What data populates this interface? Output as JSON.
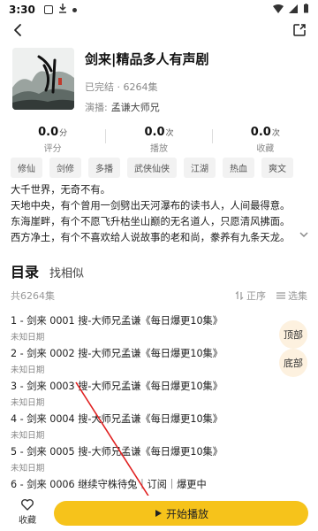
{
  "status_bar": {
    "time": "3:30"
  },
  "book": {
    "title": "剑来|精品多人有声剧",
    "meta": "已完结 · 6264集",
    "cast_label": "演播:",
    "caster": "孟谦大师兄"
  },
  "stats": [
    {
      "value": "0.0",
      "unit": "分",
      "label": "评分"
    },
    {
      "value": "0.0",
      "unit": "次",
      "label": "播放"
    },
    {
      "value": "0.0",
      "unit": "次",
      "label": "收藏"
    }
  ],
  "tags": [
    "修仙",
    "剑修",
    "多播",
    "武侠仙侠",
    "江湖",
    "热血",
    "爽文"
  ],
  "description": [
    "大千世界，无奇不有。",
    "天地中央，有个曾用一剑劈出天河瀑布的读书人，人间最得意。",
    "东海崖畔，有个不愿飞升枯坐山巅的无名道人，只愿清风拂面。",
    "西方净土，有个不喜欢给人说故事的老和尚，豢养有九条天龙。"
  ],
  "catalog": {
    "title": "目录",
    "similar": "找相似",
    "count": "共6264集",
    "sort_label": "正序",
    "select_label": "选集"
  },
  "episodes": [
    {
      "title": "1 - 剑来 0001 搜-大师兄孟谦《每日爆更10集》",
      "date": "未知日期"
    },
    {
      "title": "2 - 剑来 0002 搜-大师兄孟谦《每日爆更10集》",
      "date": "未知日期"
    },
    {
      "title": "3 - 剑来 0003 搜-大师兄孟谦《每日爆更10集》",
      "date": "未知日期"
    },
    {
      "title": "4 - 剑来 0004 搜-大师兄孟谦《每日爆更10集》",
      "date": "未知日期"
    },
    {
      "title": "5 - 剑来 0005 搜-大师兄孟谦《每日爆更10集》",
      "date": "未知日期"
    },
    {
      "title": "6 - 剑来 0006 继续守株待兔｜订阅｜爆更中",
      "date": ""
    }
  ],
  "float_buttons": {
    "top": "顶部",
    "bottom": "底部"
  },
  "bottom_bar": {
    "favorite_label": "收藏",
    "play_label": "开始播放"
  },
  "colors": {
    "accent": "#f6c31b",
    "annotation": "#e02020"
  }
}
